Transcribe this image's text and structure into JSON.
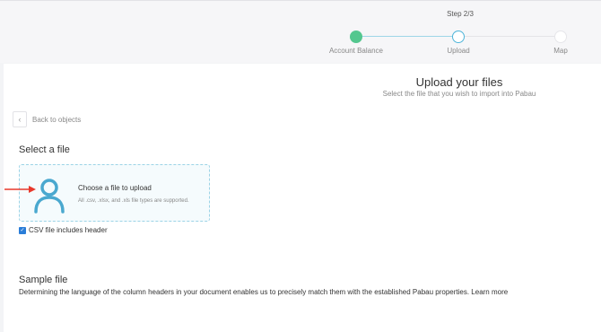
{
  "stepper": {
    "step_counter": "Step 2/3",
    "steps": [
      {
        "label": "Account Balance",
        "state": "done"
      },
      {
        "label": "Upload",
        "state": "active"
      },
      {
        "label": "Map",
        "state": "todo"
      }
    ]
  },
  "header": {
    "title": "Upload your files",
    "subtitle": "Select the file that you wish to import into Pabau"
  },
  "nav": {
    "back_label": "Back to objects",
    "back_icon": "chevron-left-icon"
  },
  "select_section": {
    "title": "Select a file",
    "dropzone": {
      "icon": "user-icon",
      "title": "Choose a file to upload",
      "subtitle": "All .csv, .xlsx, and .xls file types are supported."
    },
    "checkbox": {
      "label": "CSV file includes header",
      "checked": true
    }
  },
  "sample_section": {
    "title": "Sample file",
    "description": "Determining the language of the column headers in your document enables us to precisely match them with the established Pabau properties. Learn more"
  },
  "colors": {
    "done": "#54c78f",
    "active": "#4fb5d9",
    "icon": "#4aa8cf",
    "annotation_arrow": "#e8382b",
    "checkbox": "#2a7dd8"
  }
}
